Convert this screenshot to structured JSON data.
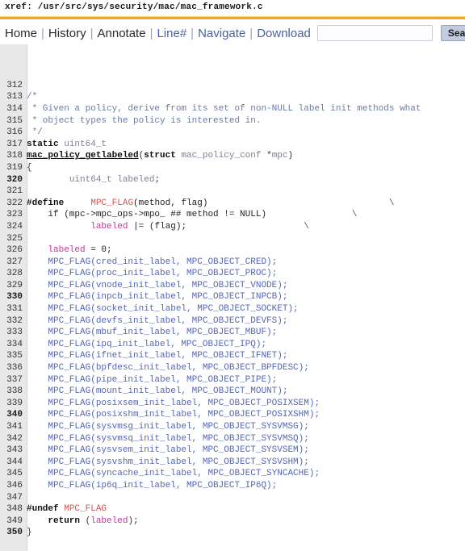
{
  "header": {
    "xref_label": "xref: /usr/src/sys/security/mac/mac_framework.c"
  },
  "menubar": {
    "items": [
      {
        "label": "Home",
        "style": "dark"
      },
      {
        "label": "History",
        "style": "dark"
      },
      {
        "label": "Annotate",
        "style": "dark"
      },
      {
        "label": "Line#",
        "style": "blue"
      },
      {
        "label": "Navigate",
        "style": "blue"
      },
      {
        "label": "Download",
        "style": "blue"
      }
    ],
    "separator": "|",
    "search_value": "",
    "search_placeholder": "",
    "search_button_label": "Search"
  },
  "code": {
    "lines": [
      {
        "num": "312",
        "tokens": []
      },
      {
        "num": "313",
        "tokens": [
          {
            "t": "/*",
            "c": "t-comment"
          }
        ]
      },
      {
        "num": "314",
        "tokens": [
          {
            "t": " * Given a policy, derive from its set of non-NULL label init methods what",
            "c": "t-comment"
          }
        ]
      },
      {
        "num": "315",
        "tokens": [
          {
            "t": " * object types the policy is interested in.",
            "c": "t-comment"
          }
        ]
      },
      {
        "num": "316",
        "tokens": [
          {
            "t": " */",
            "c": "t-comment"
          }
        ]
      },
      {
        "num": "317",
        "tokens": [
          {
            "t": "static ",
            "c": "t-kw"
          },
          {
            "t": "uint64_t",
            "c": "t-type"
          }
        ]
      },
      {
        "num": "318",
        "tokens": [
          {
            "t": "mac_policy_getlabeled",
            "c": "t-def"
          },
          {
            "t": "(",
            "c": "t-punct"
          },
          {
            "t": "struct ",
            "c": "t-kw"
          },
          {
            "t": "mac_policy_conf",
            "c": "t-type"
          },
          {
            "t": " *",
            "c": "t-punct"
          },
          {
            "t": "mpc",
            "c": "t-type"
          },
          {
            "t": ")",
            "c": "t-punct"
          }
        ]
      },
      {
        "num": "319",
        "tokens": [
          {
            "t": "{",
            "c": "t-punct"
          }
        ]
      },
      {
        "num": "320",
        "tokens": [
          {
            "t": "        ",
            "c": "t-plain"
          },
          {
            "t": "uint64_t",
            "c": "t-type"
          },
          {
            "t": " ",
            "c": "t-plain"
          },
          {
            "t": "labeled",
            "c": "t-type"
          },
          {
            "t": ";",
            "c": "t-punct"
          }
        ]
      },
      {
        "num": "321",
        "tokens": []
      },
      {
        "num": "322",
        "tokens": [
          {
            "t": "#define",
            "c": "t-kw"
          },
          {
            "t": "     ",
            "c": "t-plain"
          },
          {
            "t": "MPC_FLAG",
            "c": "t-macro"
          },
          {
            "t": "(method, flag)",
            "c": "t-plain"
          },
          {
            "t": "                                  ",
            "c": "t-plain"
          },
          {
            "t": "\\",
            "c": "t-cont"
          }
        ]
      },
      {
        "num": "323",
        "tokens": [
          {
            "t": "    ",
            "c": "t-plain"
          },
          {
            "t": "if",
            "c": "t-plain"
          },
          {
            "t": " (mpc->mpc_ops->mpo_ ",
            "c": "t-plain"
          },
          {
            "t": "##",
            "c": "t-plain"
          },
          {
            "t": " method != NULL)",
            "c": "t-plain"
          },
          {
            "t": "                ",
            "c": "t-plain"
          },
          {
            "t": "\\",
            "c": "t-cont"
          }
        ]
      },
      {
        "num": "324",
        "tokens": [
          {
            "t": "            ",
            "c": "t-plain"
          },
          {
            "t": "labeled",
            "c": "t-var"
          },
          {
            "t": " |= (flag);",
            "c": "t-plain"
          },
          {
            "t": "                      ",
            "c": "t-plain"
          },
          {
            "t": "\\",
            "c": "t-cont"
          }
        ]
      },
      {
        "num": "325",
        "tokens": []
      },
      {
        "num": "326",
        "tokens": [
          {
            "t": "    ",
            "c": "t-plain"
          },
          {
            "t": "labeled",
            "c": "t-var"
          },
          {
            "t": " = 0;",
            "c": "t-plain"
          }
        ]
      },
      {
        "num": "327",
        "tokens": [
          {
            "t": "    ",
            "c": "t-plain"
          },
          {
            "t": "MPC_FLAG(cred_init_label, MPC_OBJECT_CRED);",
            "c": "t-sym"
          }
        ]
      },
      {
        "num": "328",
        "tokens": [
          {
            "t": "    ",
            "c": "t-plain"
          },
          {
            "t": "MPC_FLAG(proc_init_label, MPC_OBJECT_PROC);",
            "c": "t-sym"
          }
        ]
      },
      {
        "num": "329",
        "tokens": [
          {
            "t": "    ",
            "c": "t-plain"
          },
          {
            "t": "MPC_FLAG(vnode_init_label, MPC_OBJECT_VNODE);",
            "c": "t-sym"
          }
        ]
      },
      {
        "num": "330",
        "tokens": [
          {
            "t": "    ",
            "c": "t-plain"
          },
          {
            "t": "MPC_FLAG(inpcb_init_label, MPC_OBJECT_INPCB);",
            "c": "t-sym"
          }
        ]
      },
      {
        "num": "331",
        "tokens": [
          {
            "t": "    ",
            "c": "t-plain"
          },
          {
            "t": "MPC_FLAG(socket_init_label, MPC_OBJECT_SOCKET);",
            "c": "t-sym"
          }
        ]
      },
      {
        "num": "332",
        "tokens": [
          {
            "t": "    ",
            "c": "t-plain"
          },
          {
            "t": "MPC_FLAG(devfs_init_label, MPC_OBJECT_DEVFS);",
            "c": "t-sym"
          }
        ]
      },
      {
        "num": "333",
        "tokens": [
          {
            "t": "    ",
            "c": "t-plain"
          },
          {
            "t": "MPC_FLAG(mbuf_init_label, MPC_OBJECT_MBUF);",
            "c": "t-sym"
          }
        ]
      },
      {
        "num": "334",
        "tokens": [
          {
            "t": "    ",
            "c": "t-plain"
          },
          {
            "t": "MPC_FLAG(ipq_init_label, MPC_OBJECT_IPQ);",
            "c": "t-sym"
          }
        ]
      },
      {
        "num": "335",
        "tokens": [
          {
            "t": "    ",
            "c": "t-plain"
          },
          {
            "t": "MPC_FLAG(ifnet_init_label, MPC_OBJECT_IFNET);",
            "c": "t-sym"
          }
        ]
      },
      {
        "num": "336",
        "tokens": [
          {
            "t": "    ",
            "c": "t-plain"
          },
          {
            "t": "MPC_FLAG(bpfdesc_init_label, MPC_OBJECT_BPFDESC);",
            "c": "t-sym"
          }
        ]
      },
      {
        "num": "337",
        "tokens": [
          {
            "t": "    ",
            "c": "t-plain"
          },
          {
            "t": "MPC_FLAG(pipe_init_label, MPC_OBJECT_PIPE);",
            "c": "t-sym"
          }
        ]
      },
      {
        "num": "338",
        "tokens": [
          {
            "t": "    ",
            "c": "t-plain"
          },
          {
            "t": "MPC_FLAG(mount_init_label, MPC_OBJECT_MOUNT);",
            "c": "t-sym"
          }
        ]
      },
      {
        "num": "339",
        "tokens": [
          {
            "t": "    ",
            "c": "t-plain"
          },
          {
            "t": "MPC_FLAG(posixsem_init_label, MPC_OBJECT_POSIXSEM);",
            "c": "t-sym"
          }
        ]
      },
      {
        "num": "340",
        "tokens": [
          {
            "t": "    ",
            "c": "t-plain"
          },
          {
            "t": "MPC_FLAG(posixshm_init_label, MPC_OBJECT_POSIXSHM);",
            "c": "t-sym"
          }
        ]
      },
      {
        "num": "341",
        "tokens": [
          {
            "t": "    ",
            "c": "t-plain"
          },
          {
            "t": "MPC_FLAG(sysvmsg_init_label, MPC_OBJECT_SYSVMSG);",
            "c": "t-sym"
          }
        ]
      },
      {
        "num": "342",
        "tokens": [
          {
            "t": "    ",
            "c": "t-plain"
          },
          {
            "t": "MPC_FLAG(sysvmsq_init_label, MPC_OBJECT_SYSVMSQ);",
            "c": "t-sym"
          }
        ]
      },
      {
        "num": "343",
        "tokens": [
          {
            "t": "    ",
            "c": "t-plain"
          },
          {
            "t": "MPC_FLAG(sysvsem_init_label, MPC_OBJECT_SYSVSEM);",
            "c": "t-sym"
          }
        ]
      },
      {
        "num": "344",
        "tokens": [
          {
            "t": "    ",
            "c": "t-plain"
          },
          {
            "t": "MPC_FLAG(sysvshm_init_label, MPC_OBJECT_SYSVSHM);",
            "c": "t-sym"
          }
        ]
      },
      {
        "num": "345",
        "tokens": [
          {
            "t": "    ",
            "c": "t-plain"
          },
          {
            "t": "MPC_FLAG(syncache_init_label, MPC_OBJECT_SYNCACHE);",
            "c": "t-sym"
          }
        ]
      },
      {
        "num": "346",
        "tokens": [
          {
            "t": "    ",
            "c": "t-plain"
          },
          {
            "t": "MPC_FLAG(ip6q_init_label, MPC_OBJECT_IP6Q);",
            "c": "t-sym"
          }
        ]
      },
      {
        "num": "347",
        "tokens": []
      },
      {
        "num": "348",
        "tokens": [
          {
            "t": "#undef ",
            "c": "t-kw"
          },
          {
            "t": "MPC_FLAG",
            "c": "t-macro"
          }
        ]
      },
      {
        "num": "349",
        "tokens": [
          {
            "t": "    ",
            "c": "t-plain"
          },
          {
            "t": "return",
            "c": "t-kw"
          },
          {
            "t": " (",
            "c": "t-punct"
          },
          {
            "t": "labeled",
            "c": "t-var"
          },
          {
            "t": ");",
            "c": "t-punct"
          }
        ]
      },
      {
        "num": "350",
        "tokens": [
          {
            "t": "}",
            "c": "t-punct"
          }
        ]
      }
    ]
  },
  "colors": {
    "rule": "#f5a623",
    "gutter_bg": "#e8e8e8",
    "link_blue": "#4a5f9e",
    "symbol_blue": "#5566b5",
    "macro_red": "#d2564f",
    "variable_magenta": "#c0399a",
    "comment_blue": "#6a7ba8",
    "button_bg": "#c3cbe3"
  }
}
